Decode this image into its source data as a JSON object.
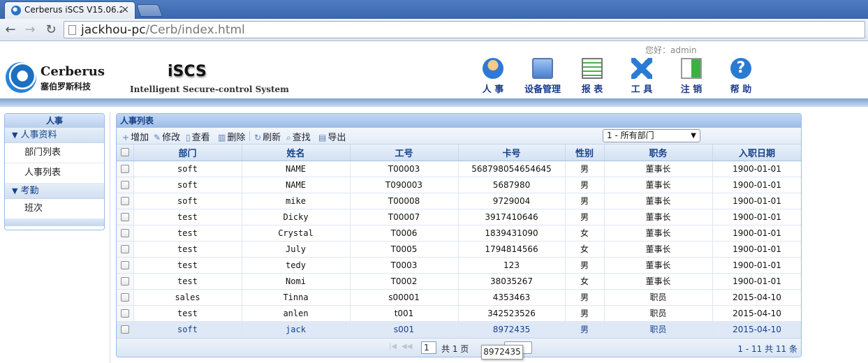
{
  "browser": {
    "tab_title": "Cerberus iSCS V15.06.2",
    "tab_close": "×",
    "url_host": "jackhou-pc",
    "url_path": "/Cerb/index.html"
  },
  "header": {
    "greeting": "您好：admin",
    "brand_name": "Cerberus",
    "brand_cn": "塞伯罗斯科技",
    "system_name": "iSCS",
    "system_subtitle": "Intelligent Secure-control System",
    "menu": [
      {
        "label": "人 事",
        "icon": "person-icon"
      },
      {
        "label": "设备管理",
        "icon": "computer-icon"
      },
      {
        "label": "报 表",
        "icon": "report-icon"
      },
      {
        "label": "工 具",
        "icon": "tools-icon"
      },
      {
        "label": "注 销",
        "icon": "logout-icon"
      },
      {
        "label": "帮 助",
        "icon": "help-icon"
      }
    ]
  },
  "sidebar": {
    "title": "人事",
    "groups": [
      {
        "label": "人事资料",
        "items": [
          "部门列表",
          "人事列表"
        ]
      },
      {
        "label": "考勤",
        "items": [
          "班次"
        ]
      }
    ]
  },
  "panel": {
    "title": "人事列表",
    "toolbar": {
      "add": "增加",
      "edit": "修改",
      "view": "查看",
      "delete": "删除",
      "refresh": "刷新",
      "search": "查找",
      "export": "导出"
    },
    "department_select": "1 - 所有部门",
    "columns": [
      "部门",
      "姓名",
      "工号",
      "卡号",
      "性别",
      "职务",
      "入职日期"
    ],
    "rows": [
      [
        "soft",
        "NAME",
        "T00003",
        "568798054654645",
        "男",
        "董事长",
        "1900-01-01"
      ],
      [
        "soft",
        "NAME",
        "T090003",
        "5687980",
        "男",
        "董事长",
        "1900-01-01"
      ],
      [
        "soft",
        "mike",
        "T00008",
        "9729004",
        "男",
        "董事长",
        "1900-01-01"
      ],
      [
        "test",
        "Dicky",
        "T00007",
        "3917410646",
        "男",
        "董事长",
        "1900-01-01"
      ],
      [
        "test",
        "Crystal",
        "T0006",
        "1839431090",
        "女",
        "董事长",
        "1900-01-01"
      ],
      [
        "test",
        "July",
        "T0005",
        "1794814566",
        "女",
        "董事长",
        "1900-01-01"
      ],
      [
        "test",
        "tedy",
        "T0003",
        "123",
        "男",
        "董事长",
        "1900-01-01"
      ],
      [
        "test",
        "Nomi",
        "T0002",
        "38035267",
        "女",
        "董事长",
        "1900-01-01"
      ],
      [
        "sales",
        "Tinna",
        "s00001",
        "4353463",
        "男",
        "职员",
        "2015-04-10"
      ],
      [
        "test",
        "anlen",
        "t001",
        "342523526",
        "男",
        "职员",
        "2015-04-10"
      ],
      [
        "soft",
        "jack",
        "s001",
        "8972435",
        "男",
        "职员",
        "2015-04-10"
      ]
    ],
    "selected_row": 10,
    "pager": {
      "page": "1",
      "total_pages_text": "共 1 页",
      "summary": "1 - 11  共 11 条"
    }
  },
  "tooltip": "8972435"
}
